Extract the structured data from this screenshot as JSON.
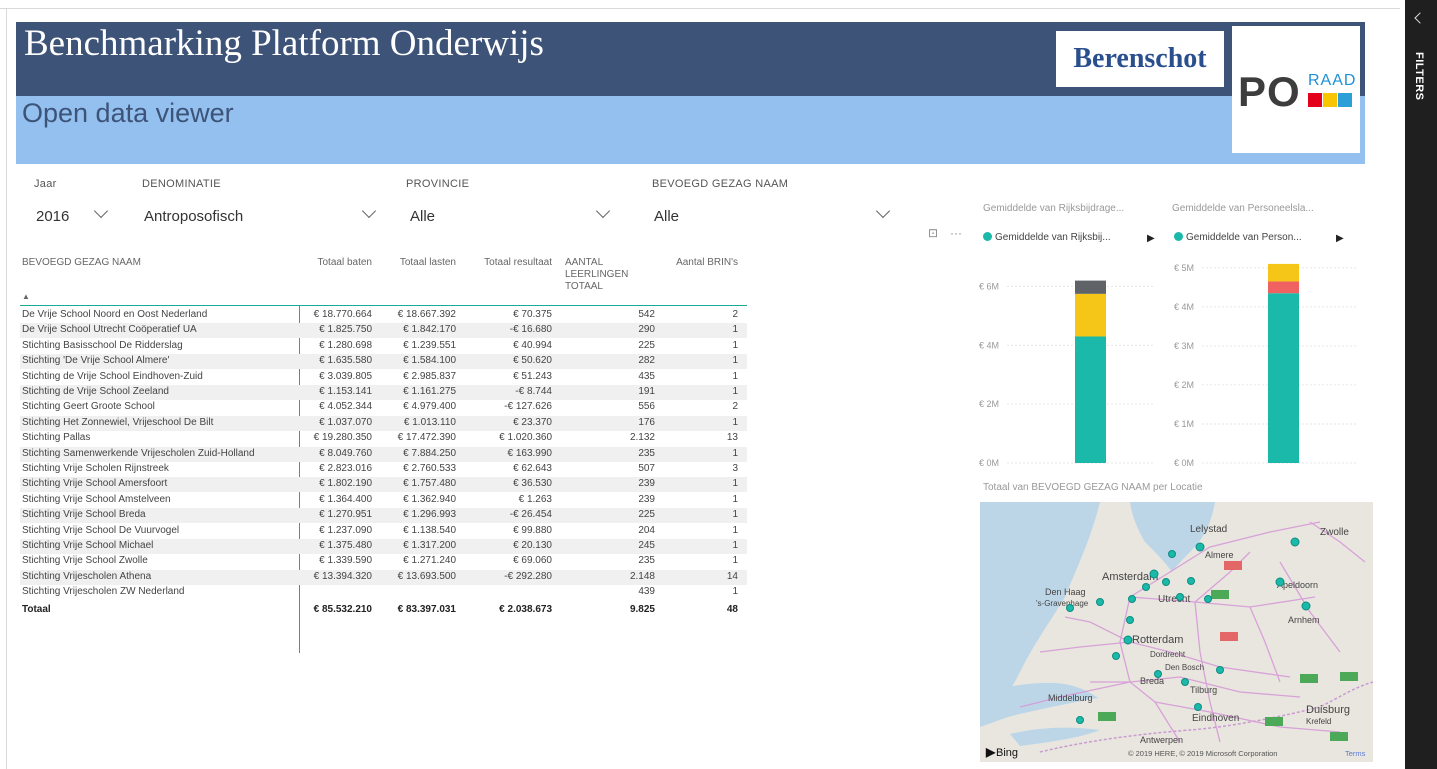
{
  "header": {
    "title": "Benchmarking Platform Onderwijs",
    "subtitle": "Open data viewer",
    "logo_berenschot": "Berenschot",
    "logo_po": "PO",
    "logo_raad": "RAAD"
  },
  "slicers": {
    "jaar_label": "Jaar",
    "jaar_value": "2016",
    "denominatie_label": "DENOMINATIE",
    "denominatie_value": "Antroposofisch",
    "provincie_label": "PROVINCIE",
    "provincie_value": "Alle",
    "bevoegd_label": "BEVOEGD GEZAG NAAM",
    "bevoegd_value": "Alle"
  },
  "table": {
    "headers": [
      "BEVOEGD GEZAG NAAM",
      "Totaal baten",
      "Totaal lasten",
      "Totaal resultaat",
      "AANTAL LEERLINGEN TOTAAL",
      "Aantal BRIN's"
    ],
    "rows": [
      [
        "De Vrije School Noord en Oost Nederland",
        "€ 18.770.664",
        "€ 18.667.392",
        "€ 70.375",
        "542",
        "2"
      ],
      [
        "De Vrije School Utrecht Coöperatief UA",
        "€ 1.825.750",
        "€ 1.842.170",
        "-€ 16.680",
        "290",
        "1"
      ],
      [
        "Stichting Basisschool De Ridderslag",
        "€ 1.280.698",
        "€ 1.239.551",
        "€ 40.994",
        "225",
        "1"
      ],
      [
        "Stichting 'De Vrije School Almere'",
        "€ 1.635.580",
        "€ 1.584.100",
        "€ 50.620",
        "282",
        "1"
      ],
      [
        "Stichting de Vrije School Eindhoven-Zuid",
        "€ 3.039.805",
        "€ 2.985.837",
        "€ 51.243",
        "435",
        "1"
      ],
      [
        "Stichting de Vrije School Zeeland",
        "€ 1.153.141",
        "€ 1.161.275",
        "-€ 8.744",
        "191",
        "1"
      ],
      [
        "Stichting Geert Groote School",
        "€ 4.052.344",
        "€ 4.979.400",
        "-€ 127.626",
        "556",
        "2"
      ],
      [
        "Stichting Het Zonnewiel, Vrijeschool De Bilt",
        "€ 1.037.070",
        "€ 1.013.110",
        "€ 23.370",
        "176",
        "1"
      ],
      [
        "Stichting Pallas",
        "€ 19.280.350",
        "€ 17.472.390",
        "€ 1.020.360",
        "2.132",
        "13"
      ],
      [
        "Stichting Samenwerkende Vrijescholen Zuid-Holland",
        "€ 8.049.760",
        "€ 7.884.250",
        "€ 163.990",
        "235",
        "1"
      ],
      [
        "Stichting Vrije Scholen Rijnstreek",
        "€ 2.823.016",
        "€ 2.760.533",
        "€ 62.643",
        "507",
        "3"
      ],
      [
        "Stichting Vrije School Amersfoort",
        "€ 1.802.190",
        "€ 1.757.480",
        "€ 36.530",
        "239",
        "1"
      ],
      [
        "Stichting Vrije School Amstelveen",
        "€ 1.364.400",
        "€ 1.362.940",
        "€ 1.263",
        "239",
        "1"
      ],
      [
        "Stichting Vrije School Breda",
        "€ 1.270.951",
        "€ 1.296.993",
        "-€ 26.454",
        "225",
        "1"
      ],
      [
        "Stichting Vrije School De Vuurvogel",
        "€ 1.237.090",
        "€ 1.138.540",
        "€ 99.880",
        "204",
        "1"
      ],
      [
        "Stichting Vrije School Michael",
        "€ 1.375.480",
        "€ 1.317.200",
        "€ 20.130",
        "245",
        "1"
      ],
      [
        "Stichting Vrije School Zwolle",
        "€ 1.339.590",
        "€ 1.271.240",
        "€ 69.060",
        "235",
        "1"
      ],
      [
        "Stichting Vrijescholen Athena",
        "€ 13.394.320",
        "€ 13.693.500",
        "-€ 292.280",
        "2.148",
        "14"
      ],
      [
        "Stichting Vrijescholen ZW Nederland",
        "",
        "",
        "",
        "439",
        "1"
      ]
    ],
    "total": [
      "Totaal",
      "€ 85.532.210",
      "€ 83.397.031",
      "€ 2.038.673",
      "9.825",
      "48"
    ]
  },
  "chart_data": [
    {
      "type": "bar",
      "title": "Gemiddelde van Rijksbijdrage...",
      "legend": "Gemiddelde van Rijksbij...",
      "yticks": [
        "€ 0M",
        "€ 2M",
        "€ 4M",
        "€ 6M"
      ],
      "ylim": [
        0,
        6.9
      ],
      "series": [
        {
          "name": "teal",
          "color": "#1ab9a9",
          "value": 4.3
        },
        {
          "name": "yellow",
          "color": "#f5c518",
          "value": 1.45
        },
        {
          "name": "gray",
          "color": "#5f6368",
          "value": 0.45
        }
      ]
    },
    {
      "type": "bar",
      "title": "Gemiddelde van Personeelsla...",
      "legend": "Gemiddelde van Person...",
      "yticks": [
        "€ 0M",
        "€ 1M",
        "€ 2M",
        "€ 3M",
        "€ 4M",
        "€ 5M"
      ],
      "ylim": [
        0,
        5.2
      ],
      "series": [
        {
          "name": "teal",
          "color": "#1ab9a9",
          "value": 4.35
        },
        {
          "name": "red",
          "color": "#f06262",
          "value": 0.3
        },
        {
          "name": "yellow",
          "color": "#f5c518",
          "value": 0.45
        }
      ]
    }
  ],
  "map": {
    "title": "Totaal van BEVOEGD GEZAG NAAM per Locatie",
    "cities": [
      "Lelystad",
      "Zwolle",
      "Almere",
      "Amsterdam",
      "Apeldoorn",
      "Den Haag",
      "'s-Gravenhage",
      "Utrecht",
      "Arnhem",
      "Rotterdam",
      "Dordrecht",
      "Den Bosch",
      "Breda",
      "Tilburg",
      "Middelburg",
      "Eindhoven",
      "Duisburg",
      "Krefeld",
      "Antwerpen"
    ],
    "bing": "Bing",
    "copyright": "© 2019 HERE, © 2019 Microsoft Corporation",
    "terms": "Terms"
  },
  "filters_pane": {
    "label": "FILTERS"
  }
}
